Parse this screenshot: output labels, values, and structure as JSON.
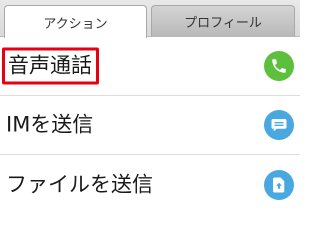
{
  "tabs": [
    {
      "label": "アクション",
      "active": true
    },
    {
      "label": "プロフィール",
      "active": false
    }
  ],
  "actions": [
    {
      "label": "音声通話",
      "icon": "phone-icon",
      "color": "#5cc03c",
      "highlighted": true
    },
    {
      "label": "IMを送信",
      "icon": "message-icon",
      "color": "#4aa8e0",
      "highlighted": false
    },
    {
      "label": "ファイルを送信",
      "icon": "file-upload-icon",
      "color": "#4aa8e0",
      "highlighted": false
    }
  ],
  "colors": {
    "highlight_border": "#e60012"
  }
}
